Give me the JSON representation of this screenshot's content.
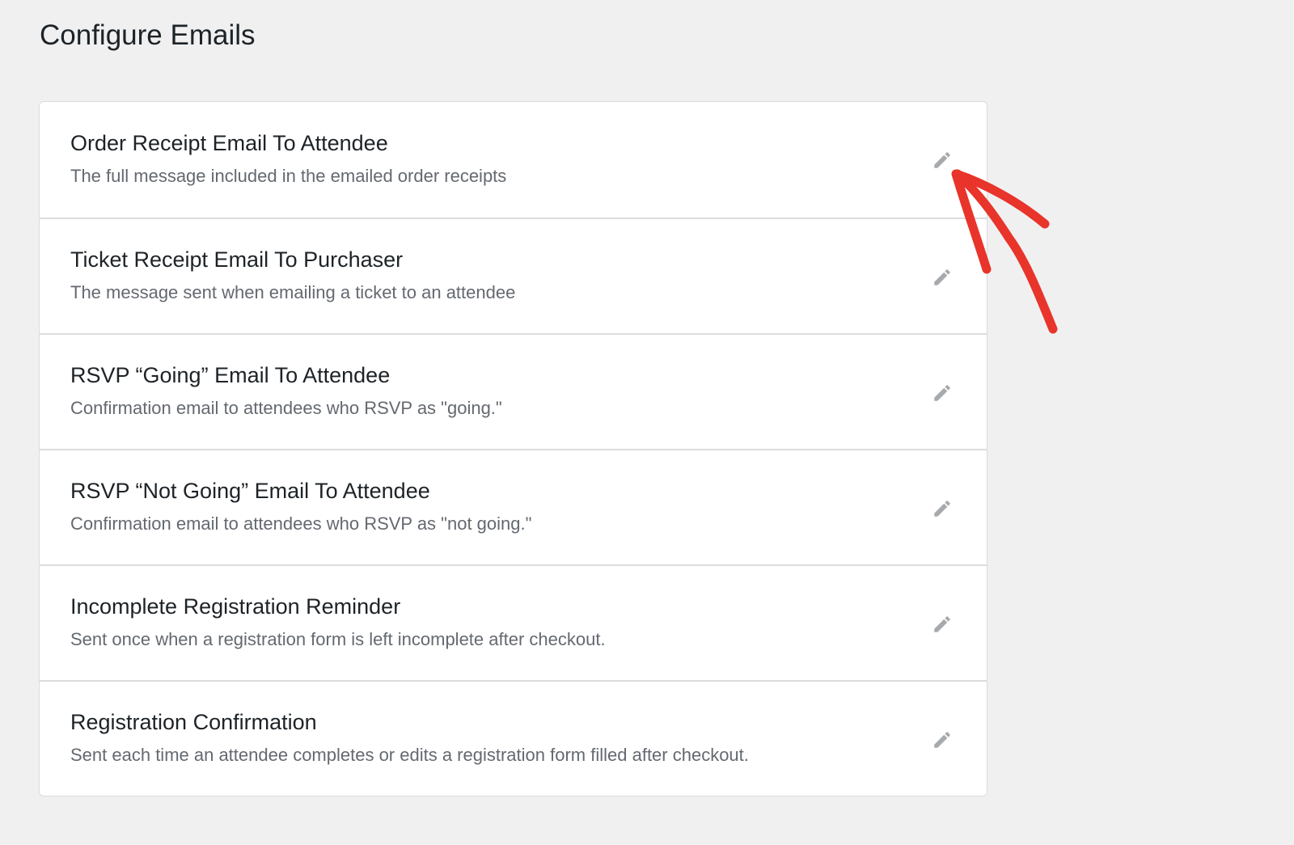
{
  "page": {
    "title": "Configure Emails"
  },
  "emails": [
    {
      "title": "Order Receipt Email To Attendee",
      "description": "The full message included in the emailed order receipts"
    },
    {
      "title": "Ticket Receipt Email To Purchaser",
      "description": "The message sent when emailing a ticket to an attendee"
    },
    {
      "title": "RSVP “Going” Email To Attendee",
      "description": "Confirmation email to attendees who RSVP as \"going.\""
    },
    {
      "title": "RSVP “Not Going” Email To Attendee",
      "description": "Confirmation email to attendees who RSVP as \"not going.\""
    },
    {
      "title": "Incomplete Registration Reminder",
      "description": "Sent once when a registration form is left incomplete after checkout."
    },
    {
      "title": "Registration Confirmation",
      "description": "Sent each time an attendee completes or edits a registration form filled after checkout."
    }
  ],
  "icons": {
    "edit": "pencil-icon",
    "annotation": "red-arrow"
  },
  "colors": {
    "background": "#f0f0f1",
    "card": "#ffffff",
    "border": "#dcdcde",
    "title_text": "#1d2327",
    "description_text": "#646970",
    "edit_icon": "#a7aaad",
    "annotation": "#e8342a"
  }
}
